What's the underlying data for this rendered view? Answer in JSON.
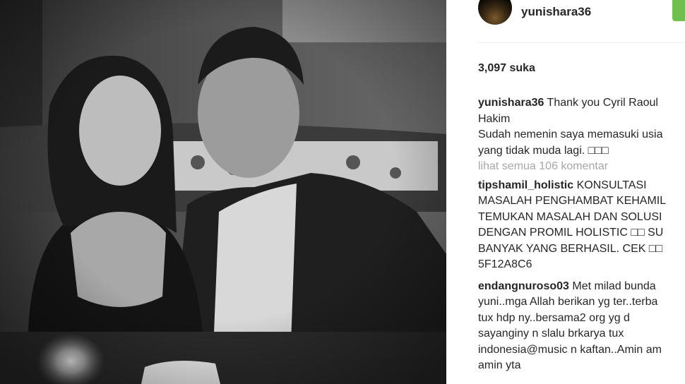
{
  "post": {
    "username": "yunishara36",
    "likes": "3,097 suka",
    "view_all_comments": "lihat semua 106 komentar",
    "caption": {
      "user": "yunishara36",
      "text": "Thank you Cyril Raoul\nHakim\nSudah nemenin saya memasuki usia\nyang tidak muda lagi. □□□"
    },
    "comments": [
      {
        "user": "tipshamil_holistic",
        "text": "KONSULTASI\nMASALAH PENGHAMBAT KEHAMIL\nTEMUKAN MASALAH DAN SOLUSI\nDENGAN PROMIL HOLISTIC □□ SU\nBANYAK YANG BERHASIL. CEK □□\n5F12A8C6"
      },
      {
        "user": "endangnuroso03",
        "text": "Met milad bunda\nyuni..mga Allah berikan yg ter..terba\ntux hdp ny..bersama2 org yg d\nsayanginy n slalu brkarya tux\nindonesia@music n kaftan..Amin am\namin yta"
      }
    ]
  },
  "colors": {
    "follow_button": "#70c050",
    "text": "#262626",
    "muted_text": "#a5a7aa"
  }
}
